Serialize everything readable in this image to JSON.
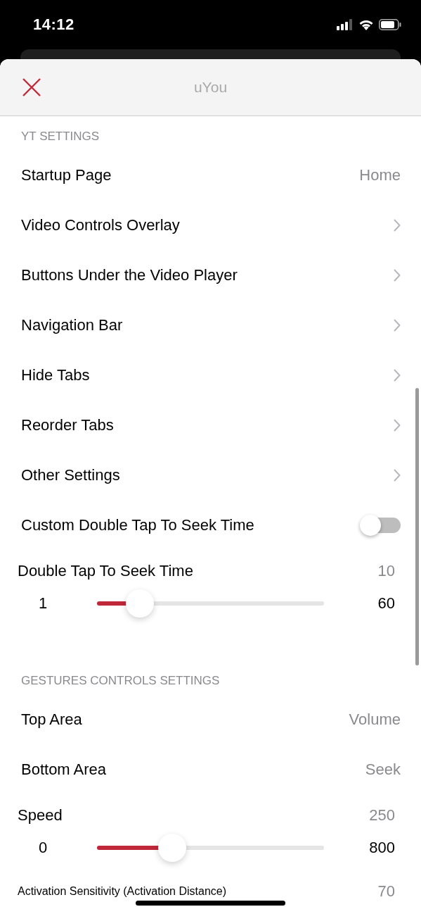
{
  "status_bar": {
    "time": "14:12"
  },
  "header": {
    "title": "uYou"
  },
  "sections": [
    {
      "title": "YT SETTINGS",
      "rows": [
        {
          "kind": "value",
          "label": "Startup Page",
          "value": "Home"
        },
        {
          "kind": "link",
          "label": "Video Controls Overlay"
        },
        {
          "kind": "link",
          "label": "Buttons Under the Video Player"
        },
        {
          "kind": "link",
          "label": "Navigation Bar"
        },
        {
          "kind": "link",
          "label": "Hide Tabs"
        },
        {
          "kind": "link",
          "label": "Reorder Tabs"
        },
        {
          "kind": "link",
          "label": "Other Settings"
        },
        {
          "kind": "toggle",
          "label": "Custom Double Tap To Seek Time",
          "on": false
        },
        {
          "kind": "slider",
          "label": "Double Tap To Seek Time",
          "value": "10",
          "min": "1",
          "max": "60",
          "level": 0.19
        }
      ]
    },
    {
      "title": "GESTURES CONTROLS SETTINGS",
      "rows": [
        {
          "kind": "value",
          "label": "Top Area",
          "value": "Volume"
        },
        {
          "kind": "value",
          "label": "Bottom Area",
          "value": "Seek"
        },
        {
          "kind": "slider",
          "label": "Speed",
          "value": "250",
          "min": "0",
          "max": "800",
          "level": 0.33
        },
        {
          "kind": "slider",
          "label": "Activation Sensitivity (Activation Distance)",
          "value": "70"
        }
      ]
    }
  ]
}
